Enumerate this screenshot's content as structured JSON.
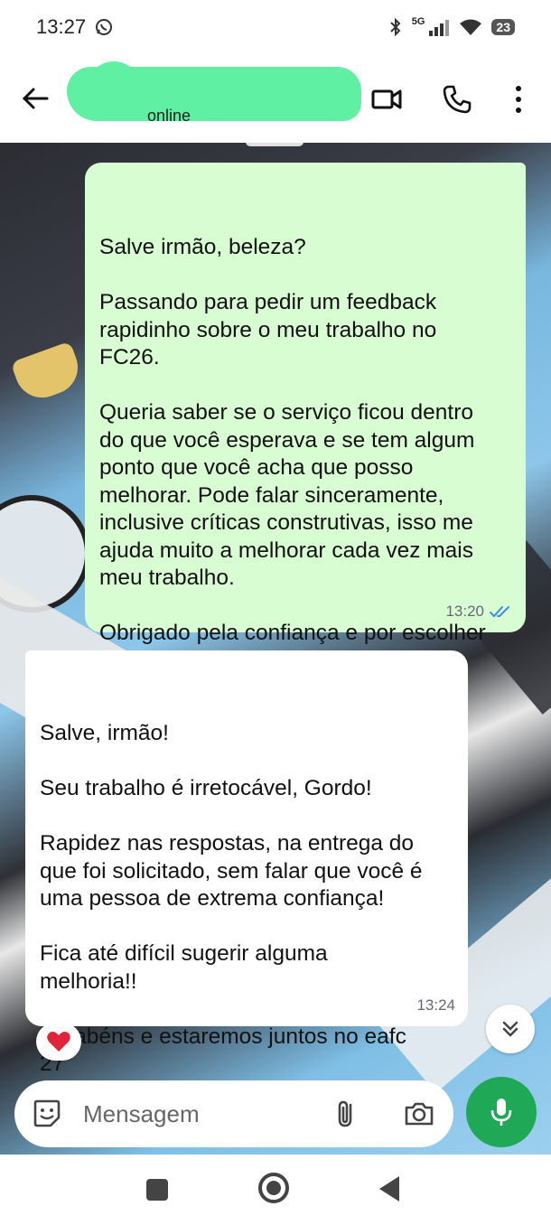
{
  "status_bar": {
    "time": "13:27",
    "network_label": "5G",
    "battery": "23"
  },
  "header": {
    "contact_status": "online"
  },
  "colors": {
    "outgoing_bubble": "#d9fdd3",
    "incoming_bubble": "#ffffff",
    "accent_green": "#1fa855",
    "read_ticks": "#3e8ee8",
    "contact_name_redaction": "#5ff0a4"
  },
  "messages": [
    {
      "direction": "outgoing",
      "text": "Salve irmão, beleza?\n\nPassando para pedir um feedback\nrapidinho sobre o meu trabalho no\nFC26.\n\nQueria saber se o serviço ficou dentro\ndo que você esperava e se tem algum\nponto que você acha que posso\nmelhorar. Pode falar sinceramente,\ninclusive críticas construtivas, isso me\najuda muito a melhorar cada vez mais\nmeu trabalho.\n\nObrigado pela confiança e por escolher\nmeu serviço! Tmj sempre! ",
      "emoji": "🤝",
      "time": "13:20",
      "status": "read"
    },
    {
      "direction": "incoming",
      "text": "Salve, irmão!\n\nSeu trabalho é irretocável, Gordo!\n\nRapidez nas respostas, na entrega do\nque foi solicitado, sem falar que você é\numa pessoa de extrema confiança!\n\nFica até difícil sugerir alguma\nmelhoria!!\n\nParabéns e estaremos juntos no eafc\n27",
      "time": "13:24",
      "reaction": "❤️"
    }
  ],
  "composer": {
    "placeholder": "Mensagem"
  },
  "icons": {
    "back": "arrow-left-icon",
    "video": "video-call-icon",
    "phone": "phone-icon",
    "more": "more-vertical-icon",
    "sticker": "sticker-icon",
    "attach": "paperclip-icon",
    "camera": "camera-icon",
    "mic": "microphone-icon",
    "scroll": "double-chevron-down-icon"
  }
}
